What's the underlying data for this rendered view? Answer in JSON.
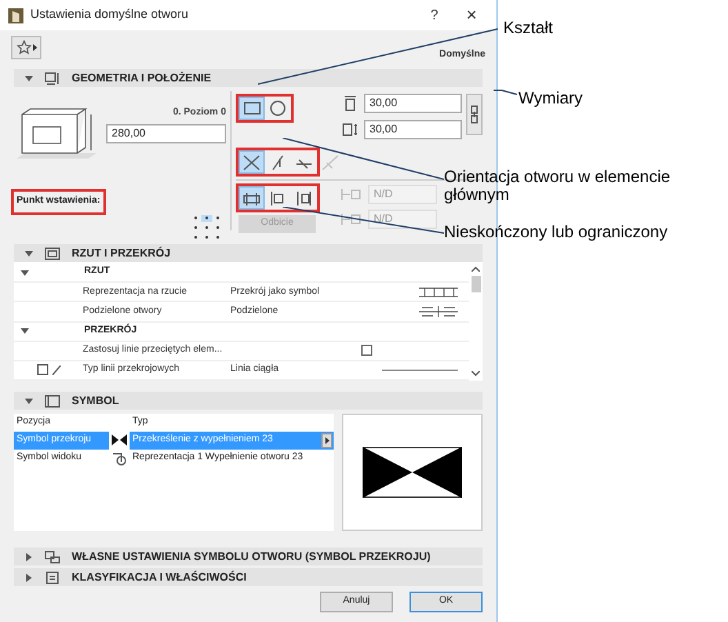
{
  "window": {
    "title": "Ustawienia domyślne otworu",
    "help": "?",
    "close": "×"
  },
  "toolbar": {
    "preset_label": "Domyślne"
  },
  "geometry": {
    "title": "GEOMETRIA I POŁOŻENIE",
    "expanded": true,
    "level_label": "0. Poziom 0",
    "height_value": "280,00",
    "anchor_label": "Punkt wstawienia:",
    "shape_options": [
      {
        "kind": "rectangle",
        "selected": true
      },
      {
        "kind": "circle",
        "selected": false
      }
    ],
    "orientation_options": [
      {
        "selected": true,
        "disabled": false
      },
      {
        "selected": false,
        "disabled": false
      },
      {
        "selected": false,
        "disabled": false
      },
      {
        "selected": false,
        "disabled": true
      }
    ],
    "extent_options": [
      {
        "selected": true
      },
      {
        "selected": false
      },
      {
        "selected": false
      }
    ],
    "width_value": "30,00",
    "depth_value": "30,00",
    "nd_fields": [
      "N/D",
      "N/D"
    ],
    "mirror_button": "Odbicie"
  },
  "plan_section": {
    "title": "RZUT I PRZEKRÓJ",
    "expanded": true,
    "groups": [
      {
        "title": "RZUT",
        "expanded": true,
        "rows": [
          {
            "kind": "text",
            "label": "Reprezentacja na rzucie",
            "value": "Przekrój jako symbol"
          },
          {
            "kind": "text",
            "label": "Podzielone otwory",
            "value": "Podzielone"
          }
        ]
      },
      {
        "title": "PRZEKRÓJ",
        "expanded": true,
        "rows": [
          {
            "kind": "checkbox",
            "label": "Zastosuj linie przeciętych elem...",
            "checked": false
          },
          {
            "kind": "line",
            "label": "Typ linii przekrojowych",
            "value": "Linia ciągła"
          }
        ]
      }
    ]
  },
  "symbol": {
    "title": "SYMBOL",
    "expanded": true,
    "columns": [
      "Pozycja",
      "Typ"
    ],
    "rows": [
      {
        "position": "Symbol przekroju",
        "type": "Przekreślenie z wypełnieniem 23",
        "selected": true
      },
      {
        "position": "Symbol widoku",
        "type": "Reprezentacja 1 Wypełnienie otworu 23",
        "selected": false
      }
    ]
  },
  "collapsed_sections": [
    {
      "title": "WŁASNE USTAWIENIA SYMBOLU OTWORU (SYMBOL PRZEKROJU)",
      "expanded": false
    },
    {
      "title": "KLASYFIKACJA I WŁAŚCIWOŚCI",
      "expanded": false
    }
  ],
  "buttons": [
    {
      "label": "Anuluj",
      "default": false
    },
    {
      "label": "OK",
      "default": true
    }
  ],
  "annotations": [
    "Kształt",
    "Wymiary",
    "Orientacja otworu w elemencie głównym",
    "Nieskończony lub ograniczony"
  ]
}
